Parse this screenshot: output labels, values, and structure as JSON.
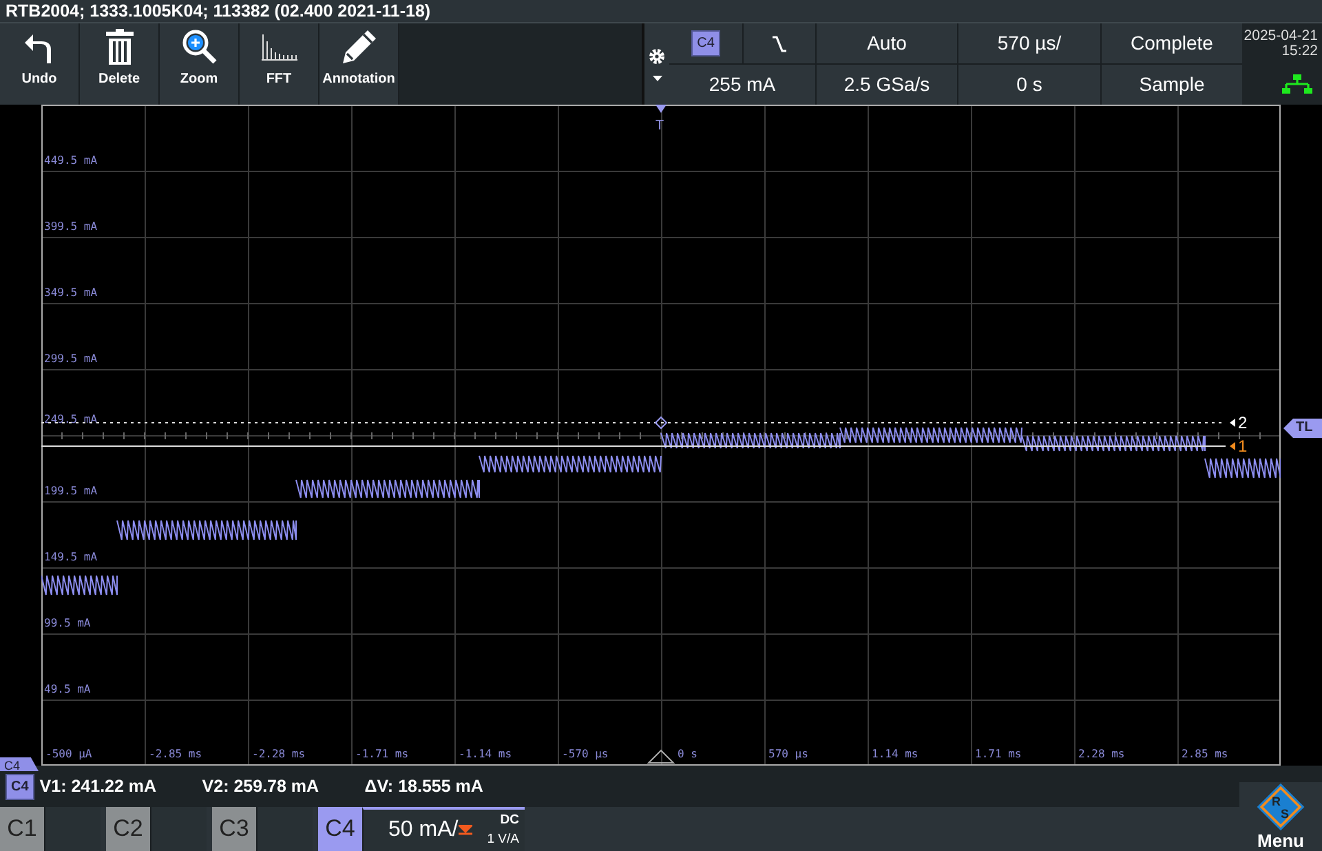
{
  "title_bar": {
    "title": "RTB2004; 1333.1005K04; 113382 (02.400 2021-11-18)"
  },
  "toolbar": [
    {
      "kind": "undo",
      "label": "Undo"
    },
    {
      "kind": "delete",
      "label": "Delete"
    },
    {
      "kind": "zoom",
      "label": "Zoom"
    },
    {
      "kind": "fft",
      "label": "FFT"
    },
    {
      "kind": "annotation",
      "label": "Annotation"
    }
  ],
  "settings": {
    "trigger_source": "C4",
    "trigger_level": "255 mA",
    "trigger_mode": "Auto",
    "sample_rate": "2.5 GSa/s",
    "time_scale": "570 µs/",
    "trigger_offset": "0 s",
    "record": "Complete",
    "acquisition": "Sample",
    "date": "2025-04-21",
    "time": "15:22"
  },
  "plot": {
    "y_labels": [
      "449.5 mA",
      "399.5 mA",
      "349.5 mA",
      "299.5 mA",
      "249.5 mA",
      "199.5 mA",
      "149.5 mA",
      "99.5 mA",
      "49.5 mA"
    ],
    "x_labels": [
      "-500 µA",
      "-2.85 ms",
      "-2.28 ms",
      "-1.71 ms",
      "-1.14 ms",
      "-570 µs",
      "0 s",
      "570 µs",
      "1.14 ms",
      "1.71 ms",
      "2.28 ms",
      "2.85 ms"
    ],
    "trigger_marker": "T",
    "cursor_2": "2",
    "cursor_1": "1",
    "trigger_level_tag": "TL",
    "channel_tag": "C4"
  },
  "measurement": {
    "channel": "C4",
    "v1": "V1: 241.22 mA",
    "v2": "V2: 259.78 mA",
    "dv": "ΔV: 18.555 mA"
  },
  "channels": [
    {
      "label": "C1",
      "active": false
    },
    {
      "label": "C2",
      "active": false
    },
    {
      "label": "C3",
      "active": false
    },
    {
      "label": "C4",
      "active": true,
      "scale": "50 mA/",
      "coupling": "DC",
      "probe": "1 V/A"
    }
  ],
  "menu": {
    "label": "Menu",
    "logo_letters": [
      "R",
      "S"
    ]
  }
}
